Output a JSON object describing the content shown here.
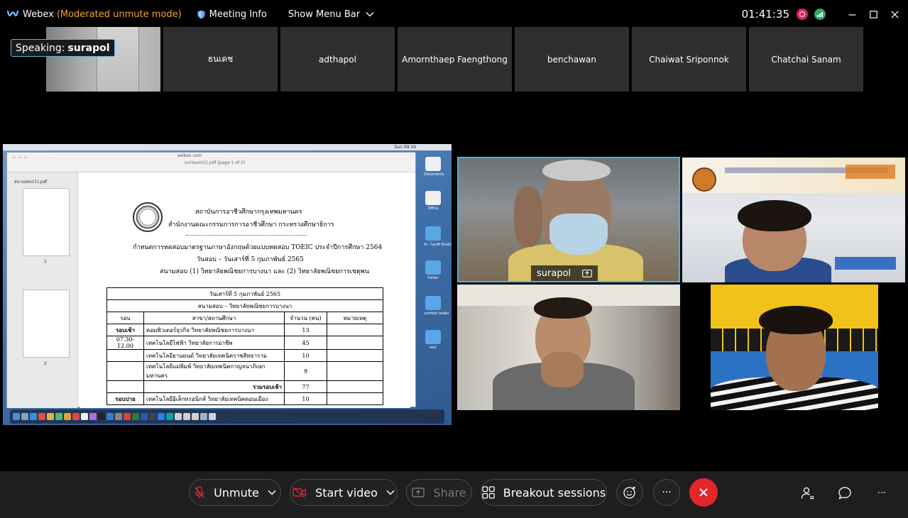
{
  "titlebar": {
    "app_name": "Webex",
    "mode_label": "(Moderated unmute mode)",
    "meeting_info": "Meeting Info",
    "show_menu_bar": "Show Menu Bar",
    "timer": "01:41:35"
  },
  "speaking": {
    "prefix": "Speaking:",
    "name": "surapol"
  },
  "filmstrip": {
    "tiles": [
      "ธนเดช",
      "adthapol",
      "Amornthaep Faengthong",
      "benchawan",
      "Chaiwat Sriponnok",
      "Chatchai Sanam"
    ]
  },
  "shared_screen": {
    "menubar_time": "Sun 09:19",
    "url": "webex.com",
    "file_name": "surlaum(1).pdf (page 1 of 2)",
    "sidebar_title": "สนามสอบ(1).pdf",
    "thumb_pages": [
      "1",
      "2"
    ],
    "doc": {
      "org1": "สถาบันการอาชีวศึกษากรุงเทพมหานคร",
      "org2": "สำนักงานคณะกรรมการการอาชีวศึกษา  กระทรวงศึกษาธิการ",
      "heading": "กำหนดการทดสอบมาตรฐานภาษาอังกฤษด้วยแบบทดสอบ TOEIC ประจำปีการศึกษา 2564",
      "dates": "วันสอบ – วันเสาร์ที่ 5 กุมภาพันธ์ 2565",
      "venues": "สนามสอบ (1) วิทยาลัยพณิชยการบางนา และ (2) วิทยาลัยพณิชยการเชตุพน",
      "table_title1": "วันเสาร์ที่ 5 กุมภาพันธ์ 2565",
      "table_title2": "สนามสอบ – วิทยาลัยพณิชยการบางนา",
      "headers": [
        "รอบ",
        "สาขา/สถานศึกษา",
        "จำนวน (คน)",
        "หมายเหตุ"
      ],
      "rows": [
        [
          "รอบเช้า",
          "คอมพิวเตอร์ธุรกิจ วิทยาลัยพณิชยการบางนา",
          "13",
          ""
        ],
        [
          "07.30-12.00",
          "เทคโนโลยีไฟฟ้า วิทยาลัยการอาชีพ",
          "45",
          ""
        ],
        [
          "",
          "เทคโนโลยียานยนต์ วิทยาลัยเทคนิคราชสิทธาราม",
          "10",
          ""
        ],
        [
          "",
          "เทคโนโลยีแม่พิมพ์ วิทยาลัยเทคนิคกาญจนาภิเษก มหานคร",
          "9",
          ""
        ],
        [
          "",
          "รวมรอบเช้า",
          "77",
          ""
        ],
        [
          "รอบบ่าย",
          "เทคโนโลยีอิเล็กทรอนิกส์ วิทยาลัยเทคนิคดอนเมือง",
          "10",
          ""
        ]
      ]
    },
    "desktop_icons": [
      "Documents",
      "Office",
      "สำ. โอเรซิ Studio",
      "Folder",
      "untitled folder",
      "test"
    ]
  },
  "videos": {
    "active_name": "surapol"
  },
  "controls": {
    "unmute": "Unmute",
    "start_video": "Start video",
    "share": "Share",
    "breakout": "Breakout sessions",
    "more": "···"
  },
  "colors": {
    "accent": "#3fb5e8",
    "mode": "#f5a623",
    "end_call": "#e3262b",
    "record": "#e0245e",
    "network": "#2fa56a"
  }
}
